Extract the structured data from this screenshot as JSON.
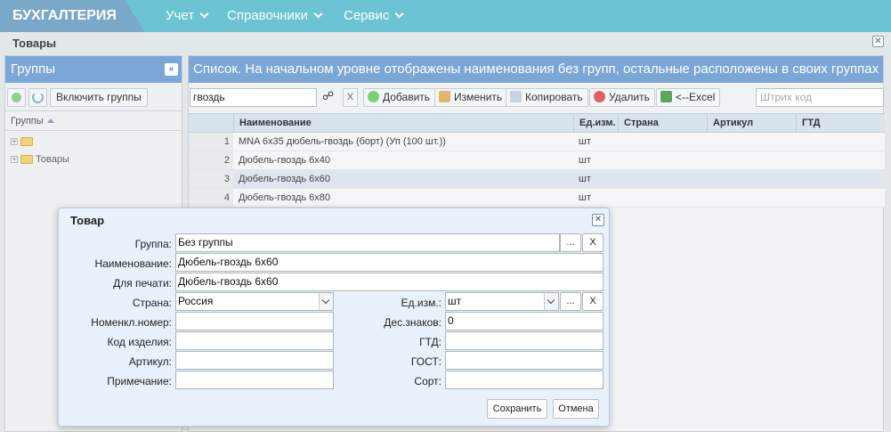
{
  "topbar": {
    "brand": "БУХГАЛТЕРИЯ",
    "menu": [
      "Учет",
      "Справочники",
      "Сервис"
    ]
  },
  "window": {
    "title": "Товары",
    "close": "✕"
  },
  "groups_panel": {
    "title": "Группы",
    "collapse": "«",
    "include_groups_label": "Включить группы",
    "column_header": "Группы",
    "tree": [
      {
        "label": ""
      },
      {
        "label": "Товары"
      }
    ]
  },
  "list_panel": {
    "title": "Список. На начальном уровне отображены наименования без групп, остальные расположены в своих группах",
    "search_value": "гвоздь",
    "clear": "X",
    "buttons": {
      "add": "Добавить",
      "edit": "Изменить",
      "copy": "Копировать",
      "delete": "Удалить",
      "excel": "<--Excel"
    },
    "barcode_placeholder": "Штрих код",
    "columns": [
      "Наименование",
      "Ед.изм.",
      "Страна",
      "Артикул",
      "ГТД"
    ],
    "rows": [
      {
        "num": "1",
        "name": "MNA 6x35 дюбель-гвоздь (борт) (Уп (100 шт.))",
        "unit": "шт"
      },
      {
        "num": "2",
        "name": "Дюбель-гвоздь 6х40",
        "unit": "шт"
      },
      {
        "num": "3",
        "name": "Дюбель-гвоздь 6х60",
        "unit": "шт"
      },
      {
        "num": "4",
        "name": "Дюбель-гвоздь 6х80",
        "unit": "шт"
      }
    ],
    "selected_row": 3
  },
  "dialog": {
    "title": "Товар",
    "close": "✕",
    "labels": {
      "group": "Группа:",
      "name": "Наименование:",
      "print": "Для печати:",
      "country": "Страна:",
      "nomen": "Номенкл.номер:",
      "code": "Код изделия:",
      "article": "Артикул:",
      "note": "Примечание:",
      "unit": "Ед.изм.:",
      "decimals": "Дес.знаков:",
      "gtd": "ГТД:",
      "gost": "ГОСТ:",
      "sort": "Сорт:"
    },
    "values": {
      "group": "Без группы",
      "name": "Дюбель-гвоздь 6х60",
      "print": "Дюбель-гвоздь 6х60",
      "country": "Россия",
      "nomen": "",
      "code": "",
      "article": "",
      "note": "",
      "unit": "шт",
      "decimals": "0",
      "gtd": "",
      "gost": "",
      "sort": ""
    },
    "pick": "...",
    "clear": "X",
    "save": "Сохранить",
    "cancel": "Отмена"
  }
}
